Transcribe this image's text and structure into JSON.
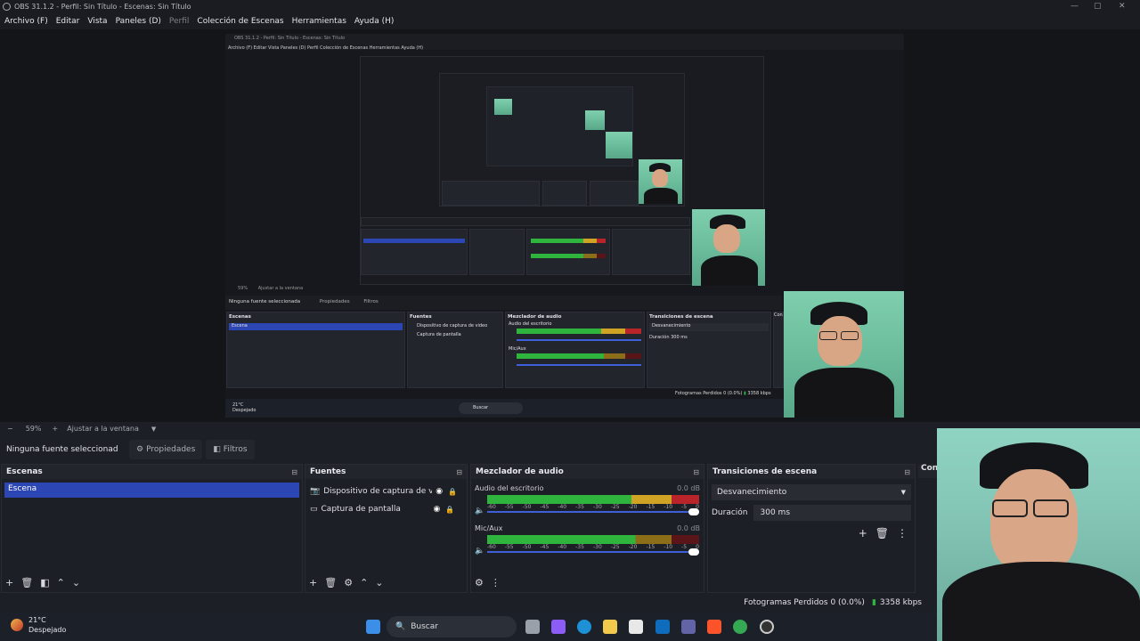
{
  "window": {
    "title": "OBS 31.1.2 - Perfil: Sin Título - Escenas: Sin Título"
  },
  "menu": {
    "items": [
      "Archivo (F)",
      "Editar",
      "Vista",
      "Paneles (D)",
      "Perfil",
      "Colección de Escenas",
      "Herramientas",
      "Ayuda (H)"
    ]
  },
  "nested": {
    "title": "OBS 31.1.2 - Perfil: Sin Título - Escenas: Sin Título",
    "menu": "Archivo (F)   Editar   Vista   Paneles (D)   Perfil   Colección de Escenas   Herramientas   Ayuda (H)",
    "zoom": "59%",
    "fit": "Ajustar a la ventana",
    "no_source": "Ninguna fuente seleccionada",
    "props": "Propiedades",
    "filters": "Filtros",
    "scenes_hd": "Escenas",
    "scene": "Escena",
    "sources_hd": "Fuentes",
    "src1": "Dispositivo de captura de video",
    "src2": "Captura de pantalla",
    "mixer_hd": "Mezclador de audio",
    "desk": "Audio del escritorio",
    "mic": "Mic/Aux",
    "trans_hd": "Transiciones de escena",
    "fade": "Desvanecimiento",
    "dur": "Duración",
    "dur_v": "300 ms",
    "controls": "Con",
    "dropped": "Fotogramas Perdidos 0 (0.0%)",
    "kbps": "3358 kbps",
    "temp": "21°C",
    "weather": "Despejado",
    "search": "Buscar"
  },
  "zoombar": {
    "minus": "−",
    "zoom": "59%",
    "plus": "+",
    "fit": "Ajustar a la ventana"
  },
  "source_bar": {
    "none_selected": "Ninguna fuente seleccionad",
    "properties": "Propiedades",
    "filters": "Filtros"
  },
  "scenes": {
    "title": "Escenas",
    "items": [
      "Escena"
    ]
  },
  "sources": {
    "title": "Fuentes",
    "items": [
      "Dispositivo de captura de video",
      "Captura de pantalla"
    ]
  },
  "mixer": {
    "title": "Mezclador de audio",
    "channels": [
      {
        "name": "Audio del escritorio",
        "db": "0.0 dB",
        "level": 0.87
      },
      {
        "name": "Mic/Aux",
        "db": "0.0 dB",
        "level": 0.7
      }
    ],
    "ticks": [
      "-60",
      "-55",
      "-50",
      "-45",
      "-40",
      "-35",
      "-30",
      "-25",
      "-20",
      "-15",
      "-10",
      "-5",
      "0"
    ]
  },
  "transitions": {
    "title": "Transiciones de escena",
    "selected": "Desvanecimiento",
    "duration_label": "Duración",
    "duration_value": "300 ms"
  },
  "controls": {
    "title": "Con"
  },
  "status": {
    "dropped": "Fotogramas Perdidos 0 (0.0%)",
    "bitrate": "3358 kbps"
  },
  "taskbar": {
    "temperature": "21°C",
    "weather": "Despejado",
    "search": "Buscar"
  },
  "colors": {
    "accent": "#2c46b4",
    "meter_green": "#2fb43d",
    "meter_yellow": "#d0a324",
    "meter_red": "#b8242a"
  }
}
